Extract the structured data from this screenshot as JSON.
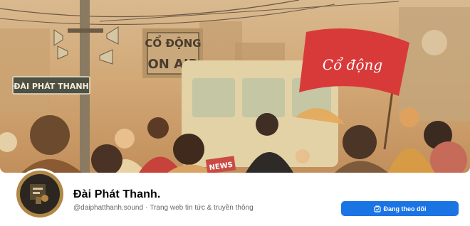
{
  "cover": {
    "street_sign": "ĐÀI PHÁT THANH",
    "billboard_top": "CỔ ĐỘNG",
    "billboard_bottom": "ON AIR",
    "flag_text": "Cổ động",
    "news_sign": "NEWS",
    "colors": {
      "flag": "#d83a3a",
      "sky": "#d9b98f",
      "sign": "#4a4a3e"
    }
  },
  "profile": {
    "name": "Đài Phát Thanh.",
    "handle": "@daiphatthanh.sound",
    "separator": "·",
    "category": "Trang web tin tức & truyền thông"
  },
  "actions": {
    "follow_label": "Đang theo dõi",
    "follow_icon": "following-icon",
    "accent": "#1b74e4"
  }
}
